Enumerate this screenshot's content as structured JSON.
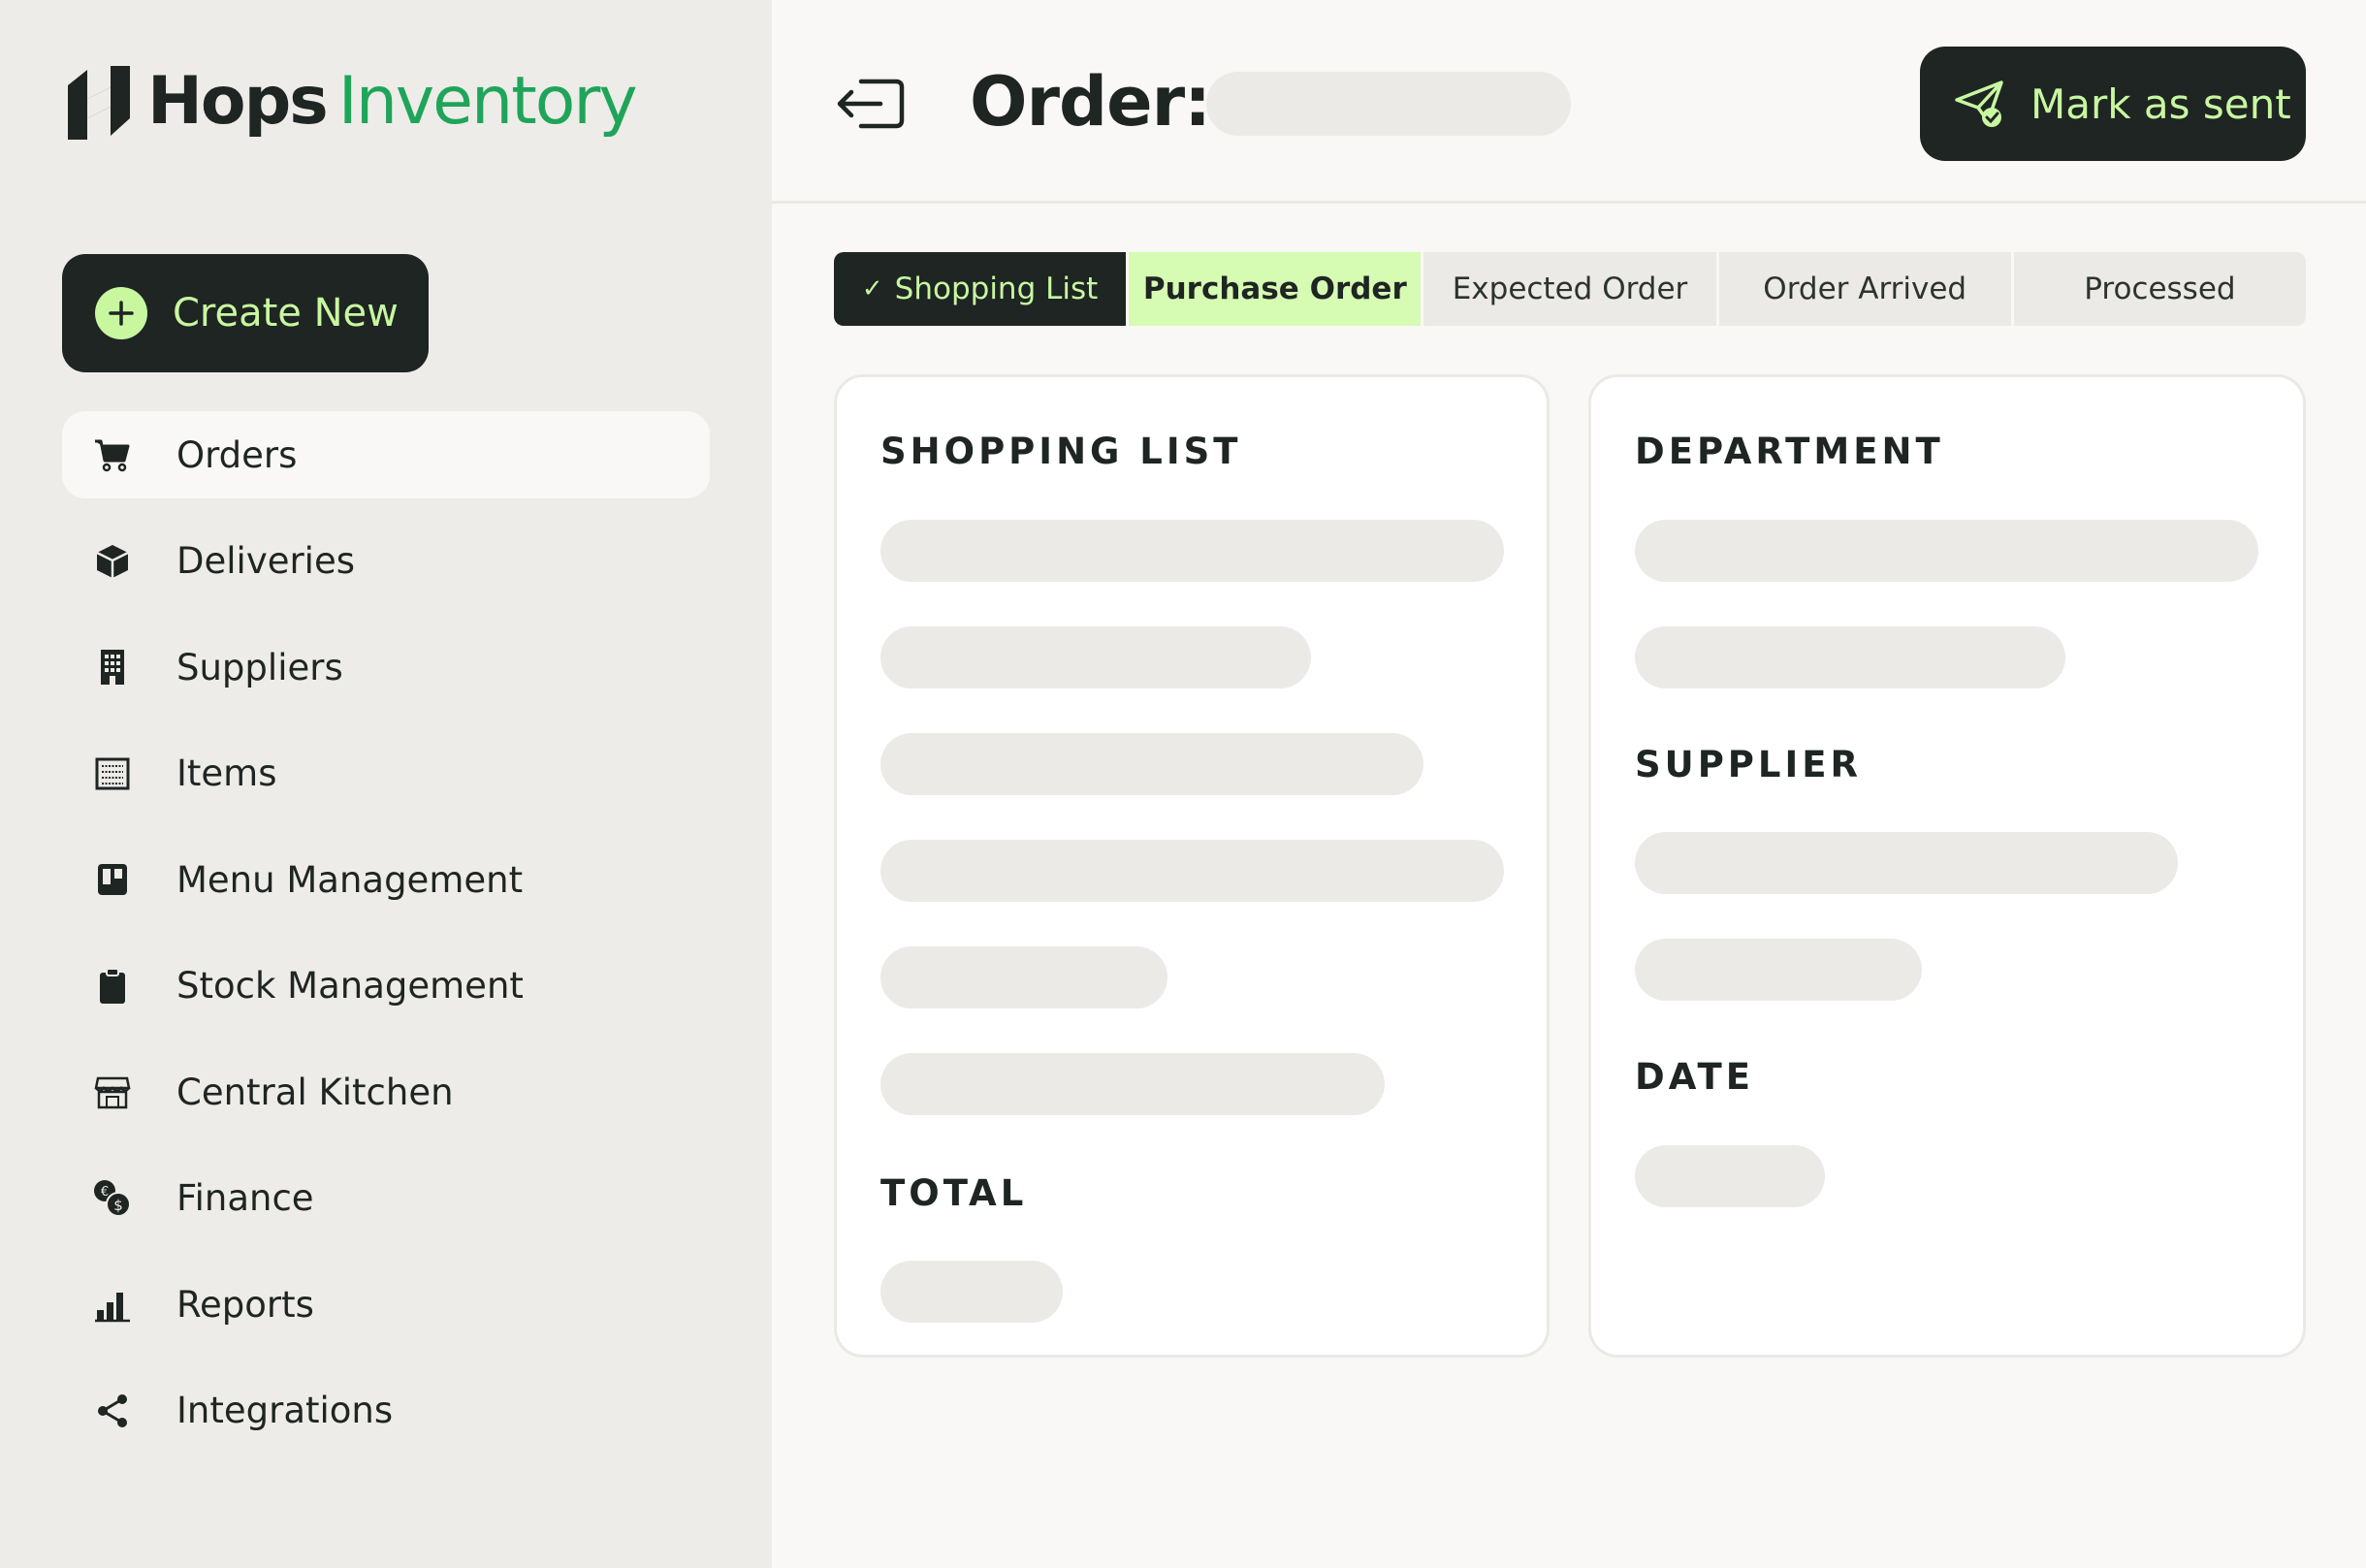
{
  "brand": {
    "part1": "Hops",
    "part2": "Inventory"
  },
  "sidebar": {
    "create_label": "Create New",
    "items": [
      {
        "label": "Orders",
        "icon": "cart-icon",
        "active": true
      },
      {
        "label": "Deliveries",
        "icon": "box-icon"
      },
      {
        "label": "Suppliers",
        "icon": "building-icon"
      },
      {
        "label": "Items",
        "icon": "list-icon"
      },
      {
        "label": "Menu Management",
        "icon": "menu-icon"
      },
      {
        "label": "Stock Management",
        "icon": "clipboard-icon"
      },
      {
        "label": "Central Kitchen",
        "icon": "store-icon"
      },
      {
        "label": "Finance",
        "icon": "coins-icon"
      },
      {
        "label": "Reports",
        "icon": "bar-chart-icon"
      },
      {
        "label": "Integrations",
        "icon": "share-icon"
      }
    ]
  },
  "header": {
    "title": "Order:",
    "mark_sent_label": "Mark as sent"
  },
  "steps": [
    {
      "label": "Shopping List",
      "state": "done"
    },
    {
      "label": "Purchase Order",
      "state": "current"
    },
    {
      "label": "Expected Order",
      "state": "pending"
    },
    {
      "label": "Order Arrived",
      "state": "pending"
    },
    {
      "label": "Processed",
      "state": "pending"
    }
  ],
  "left_card": {
    "title": "SHOPPING LIST",
    "total_label": "TOTAL"
  },
  "right_card": {
    "department_label": "DEPARTMENT",
    "supplier_label": "SUPPLIER",
    "date_label": "DATE"
  },
  "colors": {
    "dark": "#1e2523",
    "accent_green": "#c8f7a0",
    "brand_green": "#1fa55a",
    "current_step": "#d6fbb2",
    "sidebar_bg": "#eeece8",
    "skeleton": "#eceae6"
  }
}
